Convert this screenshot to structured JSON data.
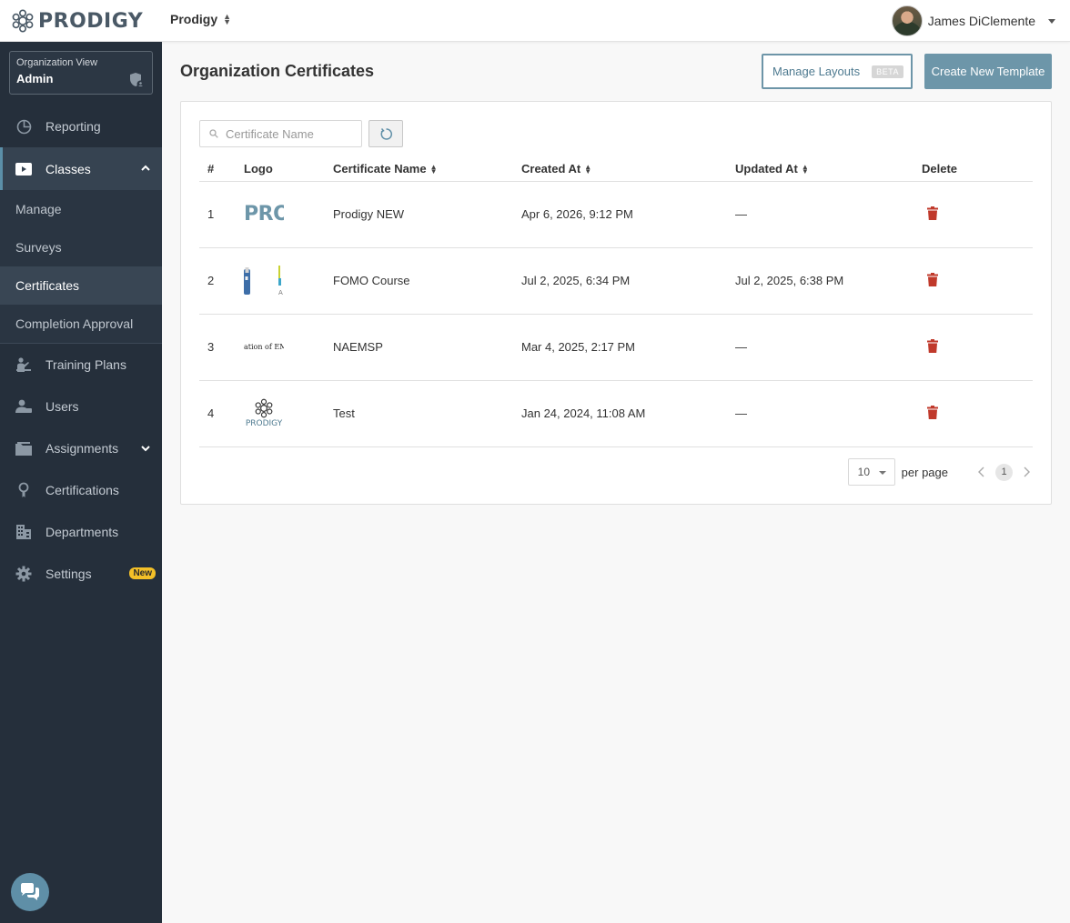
{
  "brand": {
    "name": "PRODIGY",
    "accent": "#6d96a9"
  },
  "header": {
    "org_name": "Prodigy",
    "user_name": "James DiClemente"
  },
  "sidebar": {
    "org_view": {
      "label": "Organization View",
      "value": "Admin"
    },
    "items": [
      {
        "label": "Reporting",
        "icon": "chart-pie-icon"
      },
      {
        "label": "Classes",
        "icon": "video-play-icon"
      },
      {
        "label": "Training Plans",
        "icon": "presenter-icon"
      },
      {
        "label": "Users",
        "icon": "users-icon"
      },
      {
        "label": "Assignments",
        "icon": "folder-icon"
      },
      {
        "label": "Certifications",
        "icon": "award-icon"
      },
      {
        "label": "Departments",
        "icon": "building-icon"
      },
      {
        "label": "Settings",
        "icon": "gear-icon",
        "badge": "New"
      }
    ],
    "class_subitems": [
      "Manage",
      "Surveys",
      "Certificates",
      "Completion Approval"
    ]
  },
  "main": {
    "title": "Organization Certificates",
    "manage_layouts_label": "Manage Layouts",
    "beta_label": "BETA",
    "create_label": "Create New Template",
    "search_placeholder": "Certificate Name",
    "columns": [
      "#",
      "Logo",
      "Certificate Name",
      "Created At",
      "Updated At",
      "Delete"
    ],
    "rows": [
      {
        "num": "1",
        "logo": "PRO",
        "name": "Prodigy NEW",
        "created": "Apr 6, 2026, 9:12 PM",
        "updated": "—"
      },
      {
        "num": "2",
        "logo": "",
        "name": "FOMO Course",
        "created": "Jul 2, 2025, 6:34 PM",
        "updated": "Jul 2, 2025, 6:38 PM"
      },
      {
        "num": "3",
        "logo": "ation of EM",
        "name": "NAEMSP",
        "created": "Mar 4, 2025, 2:17 PM",
        "updated": "—"
      },
      {
        "num": "4",
        "logo": "PRODIGY",
        "name": "Test",
        "created": "Jan 24, 2024, 11:08 AM",
        "updated": "—"
      }
    ],
    "pagination": {
      "per_page": "10",
      "per_page_label": "per page",
      "current_page": "1"
    }
  },
  "colors": {
    "sidebar_bg": "#252f3b",
    "delete_red": "#c0392b",
    "badge_yellow": "#f3c028"
  }
}
